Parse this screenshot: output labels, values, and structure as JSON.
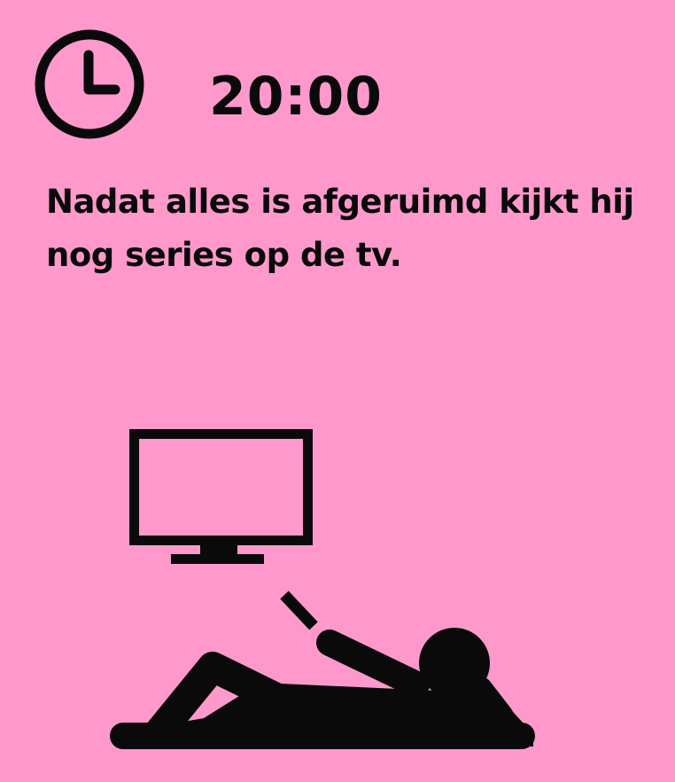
{
  "header": {
    "clock_icon": "clock-icon",
    "time": "20:00"
  },
  "caption": {
    "text": "Nadat alles is afgeruimd kijkt hij nog series op de tv."
  },
  "illustration": {
    "icons": [
      "tv-icon",
      "person-lying-remote-icon"
    ]
  },
  "colors": {
    "background": "#ff99cc",
    "ink": "#0a0a0a"
  }
}
